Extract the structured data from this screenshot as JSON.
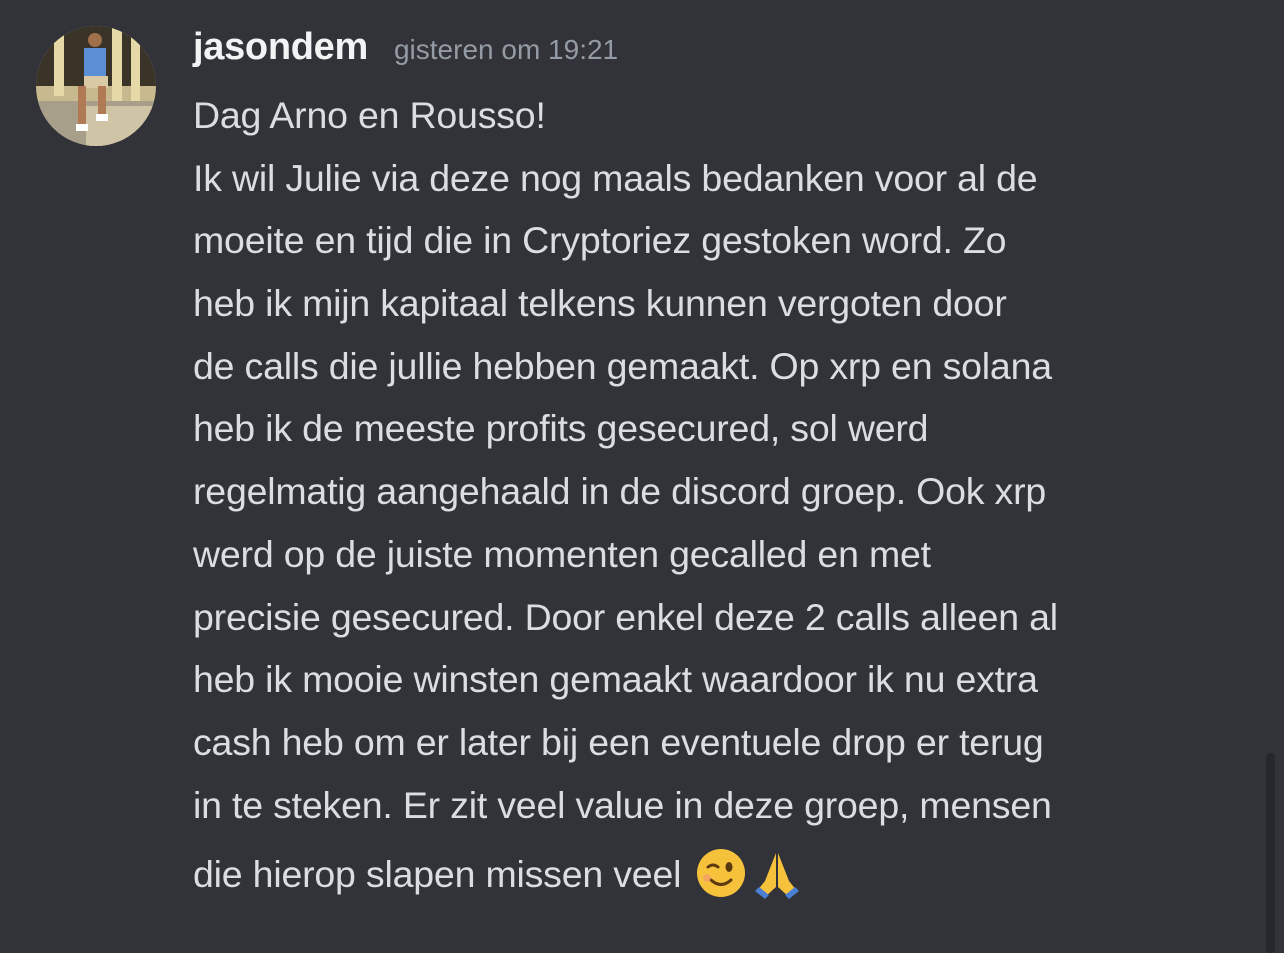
{
  "message": {
    "username": "jasondem",
    "timestamp": "gisteren om 19:21",
    "lines": [
      "Dag Arno en Rousso!",
      "Ik wil Julie via deze nog maals bedanken voor al de",
      "moeite en tijd die in Cryptoriez gestoken word. Zo",
      "heb ik mijn kapitaal telkens kunnen vergoten door",
      "de calls die jullie hebben gemaakt. Op xrp en solana",
      "heb ik de meeste profits gesecured, sol werd",
      "regelmatig aangehaald in de discord groep. Ook xrp",
      "werd op de juiste momenten gecalled en met",
      "precisie gesecured. Door enkel deze 2 calls alleen al",
      "heb ik mooie winsten gemaakt waardoor ik nu extra",
      "cash heb om er later bij een eventuele drop er terug",
      "in te steken. Er zit veel value in deze groep, mensen",
      "die hierop slapen missen veel"
    ],
    "emojis": [
      "winking-face",
      "folded-hands"
    ]
  },
  "colors": {
    "background": "#313338",
    "username": "#f2f3f5",
    "text": "#dbdee1",
    "timestamp": "#949ba4"
  }
}
